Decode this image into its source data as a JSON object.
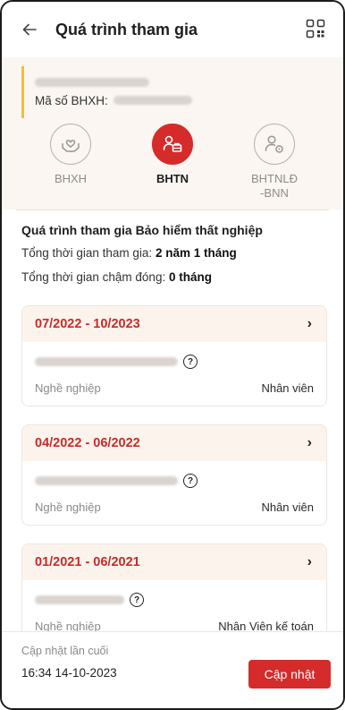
{
  "header": {
    "title": "Quá trình tham gia",
    "back_icon": "arrow-left-icon",
    "qr_icon": "qr-code-icon"
  },
  "user": {
    "ssn_label": "Mã số BHXH:"
  },
  "tabs": [
    {
      "label": "BHXH",
      "icon": "hands-heart-icon",
      "active": false
    },
    {
      "label": "BHTN",
      "icon": "person-briefcase-icon",
      "active": true
    },
    {
      "label": "BHTNLĐ\n-BNN",
      "label_line1": "BHTNLĐ",
      "label_line2": "-BNN",
      "icon": "person-gear-icon",
      "active": false
    }
  ],
  "summary": {
    "title": "Quá trình tham gia Bảo hiểm thất nghiệp",
    "total_label": "Tổng thời gian tham gia:",
    "total_value": "2 năm 1 tháng",
    "late_label": "Tổng thời gian chậm đóng:",
    "late_value": "0 tháng"
  },
  "records": [
    {
      "period": "07/2022 - 10/2023",
      "job_label": "Nghề nghiệp",
      "job_value": "Nhân viên"
    },
    {
      "period": "04/2022 - 06/2022",
      "job_label": "Nghề nghiệp",
      "job_value": "Nhân viên"
    },
    {
      "period": "01/2021 - 06/2021",
      "job_label": "Nghề nghiệp",
      "job_value": "Nhân Viên kế toán"
    }
  ],
  "footer": {
    "last_update_label": "Cập nhật lần cuối",
    "last_update_time": "16:34 14-10-2023",
    "update_button": "Cập nhật"
  },
  "colors": {
    "accent": "#d52b2b",
    "period": "#c92a2a",
    "highlight": "#f2c12e",
    "panel_bg": "#fbf6f1"
  }
}
